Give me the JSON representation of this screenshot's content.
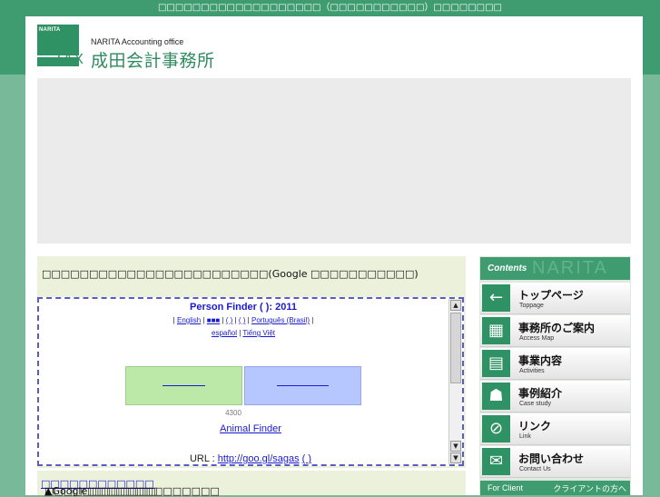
{
  "top_note": "□□□□□□□□□□□□□□□□□□□（□□□□□□□□□□□）□□□□□□□□",
  "brand": {
    "logo_small": "NARITA",
    "logo_tax": "TAX",
    "name_en": "NARITA  Accounting office",
    "name_jp": "成田会計事務所"
  },
  "main": {
    "title": "□□□□□□□□□□□□□□□□□□□□□□□□(Google  □□□□□□□□□□□)",
    "finder": {
      "title": "Person Finder (      ): 2011",
      "lang_sep_open": "|",
      "lang_english": "English",
      "lang_other1": "■■■",
      "lang_other2": "(   )",
      "lang_other3": "(   )",
      "lang_portuguese": "Português (Brasil)",
      "lang_espanol": "español",
      "lang_vietnamese": "Tiếng Việt",
      "count": "4300",
      "animal_finder": "Animal Finder",
      "url_label": "URL : ",
      "url_link": "http://goo.gl/sagas",
      "url_suffix": "(    )"
    },
    "bottom_prefix": "▲Google□□□□□□□□□□□□□□",
    "bottom_link": "□□□□□□□□□□□□",
    "bottom_suffix": "□□□□□□□□□□□□"
  },
  "sidebar": {
    "heading": "Contents",
    "heading_bg": "NARITA",
    "items": [
      {
        "jp": "トップページ",
        "en": "Toppage",
        "icon": "arrow-left-icon"
      },
      {
        "jp": "事務所のご案内",
        "en": "Access Map",
        "icon": "map-icon"
      },
      {
        "jp": "事業内容",
        "en": "Activities",
        "icon": "document-icon"
      },
      {
        "jp": "事例紹介",
        "en": "Case study",
        "icon": "people-icon"
      },
      {
        "jp": "リンク",
        "en": "Link",
        "icon": "link-icon"
      },
      {
        "jp": "お問い合わせ",
        "en": "Contact Us",
        "icon": "mail-icon"
      }
    ],
    "footer_en": "For Client",
    "footer_jp": "クライアントの方へ"
  },
  "colors": {
    "brand_green": "#2f9264",
    "header_green": "#3f9b70",
    "page_bg": "#78b99a",
    "panel_bg": "#ecf1dc"
  }
}
